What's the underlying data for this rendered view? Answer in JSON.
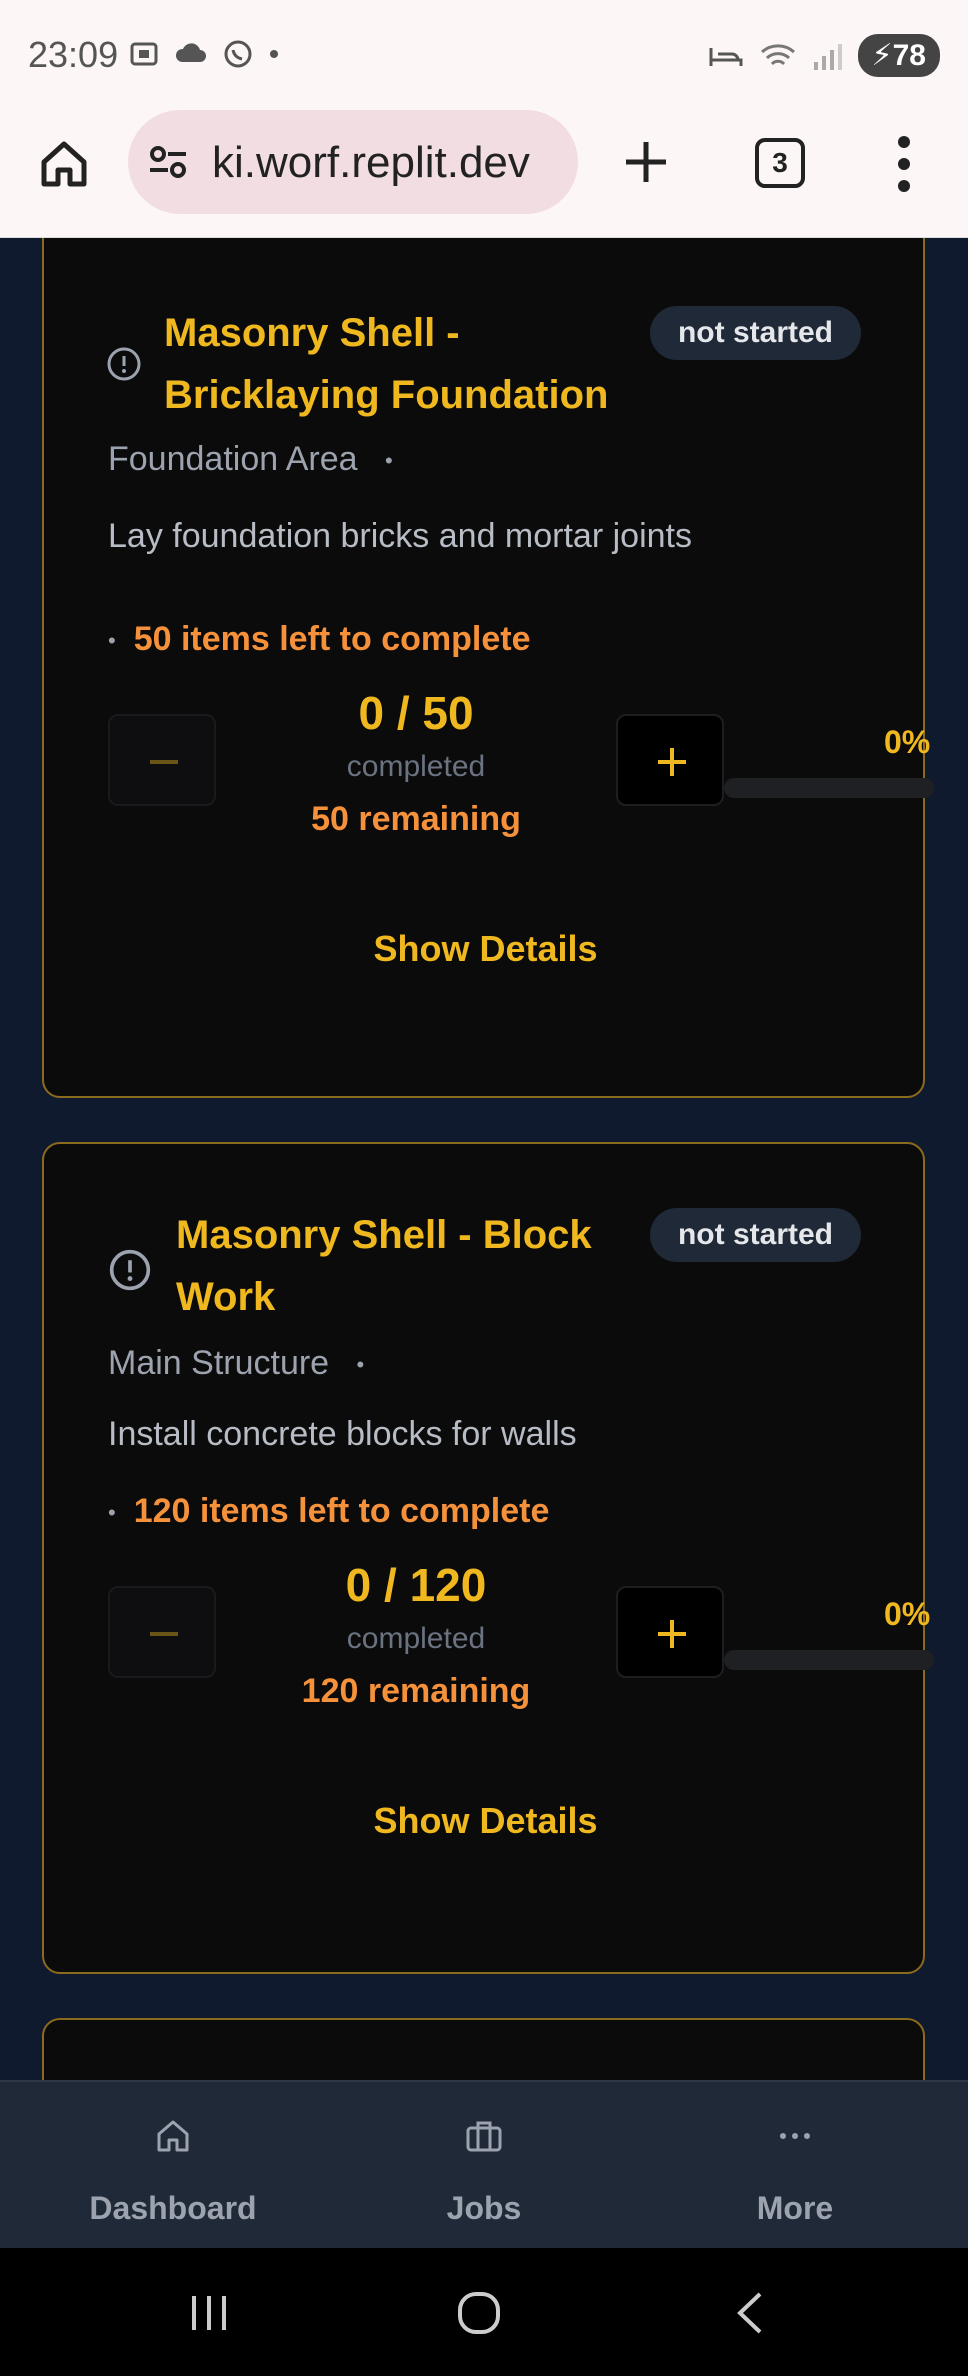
{
  "status_bar": {
    "time": "23:09",
    "battery": "78"
  },
  "browser": {
    "url": "ki.worf.replit.dev",
    "tab_count": "3"
  },
  "tasks": [
    {
      "title": "Masonry Shell - Bricklaying Foundation",
      "status": "not started",
      "location": "Foundation Area",
      "location_separator": "•",
      "description": "Lay foundation bricks and mortar joints",
      "left_text": "50 items left to complete",
      "bullet": "•",
      "count": "0 / 50",
      "completed_label": "completed",
      "remaining": "50 remaining",
      "percent": "0%",
      "progress": 0,
      "minus_label": "−",
      "plus_label": "+",
      "details_label": "Show Details"
    },
    {
      "title": "Masonry Shell - Block Work",
      "status": "not started",
      "location": "Main Structure",
      "location_separator": "•",
      "description": "Install concrete blocks for walls",
      "left_text": "120 items left to complete",
      "bullet": "•",
      "count": "0 / 120",
      "completed_label": "completed",
      "remaining": "120 remaining",
      "percent": "0%",
      "progress": 0,
      "minus_label": "−",
      "plus_label": "+",
      "details_label": "Show Details"
    }
  ],
  "bottom_nav": [
    {
      "label": "Dashboard",
      "icon": "home-icon"
    },
    {
      "label": "Jobs",
      "icon": "briefcase-icon"
    },
    {
      "label": "More",
      "icon": "more-dots-icon"
    }
  ],
  "colors": {
    "accent": "#f0b81f",
    "warning": "#f6913b",
    "background": "#0f1a2e",
    "card": "#0b0b0c"
  }
}
